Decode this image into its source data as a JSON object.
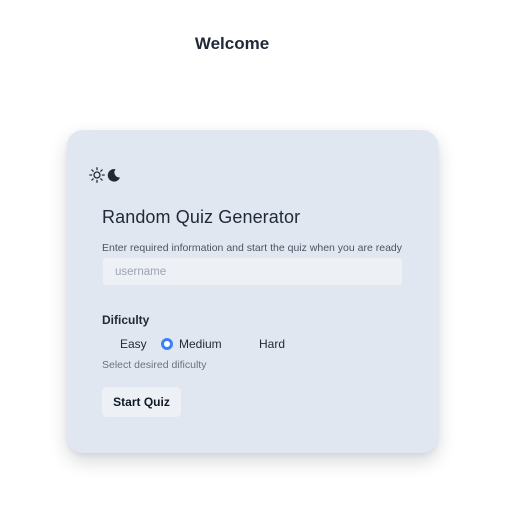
{
  "header": {
    "title": "Welcome"
  },
  "card": {
    "title": "Random Quiz Generator",
    "subtitle": "Enter required information and start the quiz when you are ready",
    "theme_toggle": {
      "icons": [
        "sun-icon",
        "moon-icon"
      ]
    },
    "username": {
      "placeholder": "username",
      "value": ""
    },
    "difficulty": {
      "label": "Dificulty",
      "options": [
        {
          "label": "Easy",
          "checked": false
        },
        {
          "label": "Medium",
          "checked": true
        },
        {
          "label": "Hard",
          "checked": false
        }
      ],
      "helper": "Select desired dificulty"
    },
    "start_button": {
      "label": "Start Quiz"
    }
  },
  "colors": {
    "card_background": "#e1e7f0",
    "input_background": "#edf1f6",
    "accent": "#3b82f6",
    "text": "#1f2937"
  }
}
